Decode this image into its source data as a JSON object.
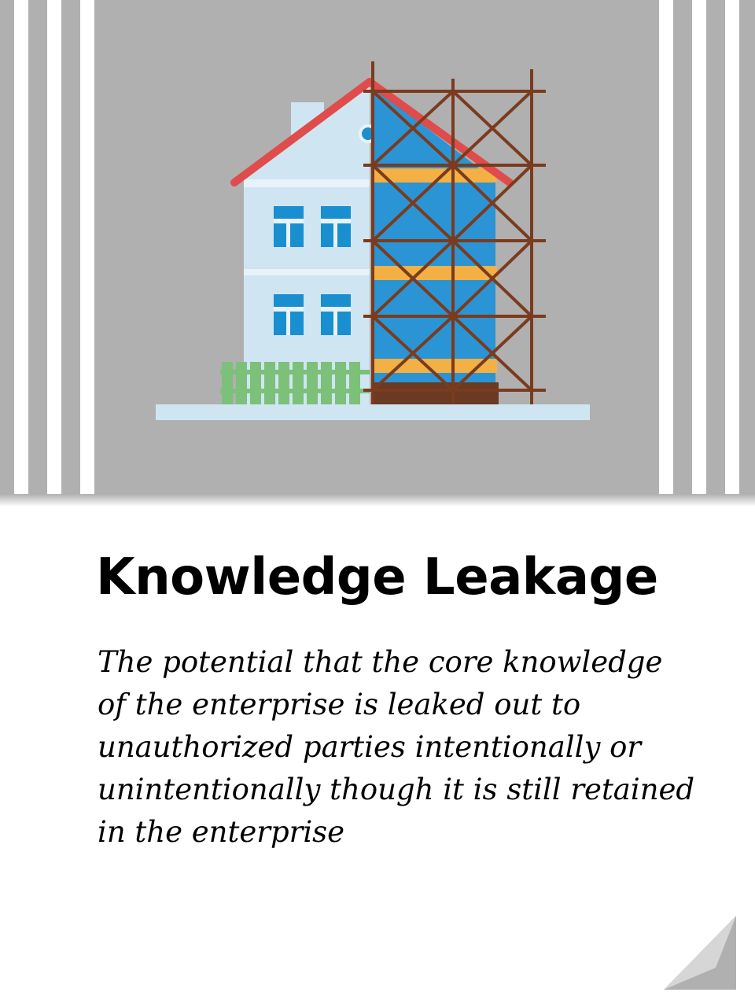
{
  "card": {
    "title": "Knowledge Leakage",
    "description": "The potential that the core knowledge of the enterprise is leaked out to unauthorized parties intentionally or unintentionally though it is still retained in the enterprise"
  },
  "illustration": {
    "icon": "house-under-construction-icon"
  },
  "colors": {
    "panel": "#b0b0b0",
    "roof": "#e04b4b",
    "house_wall": "#cfe6f2",
    "window": "#1a8fd0",
    "scaffold_cover": "#2b94d4",
    "scaffold": "#7a3b1e",
    "plank": "#f3b045",
    "fence": "#7cc07a"
  }
}
